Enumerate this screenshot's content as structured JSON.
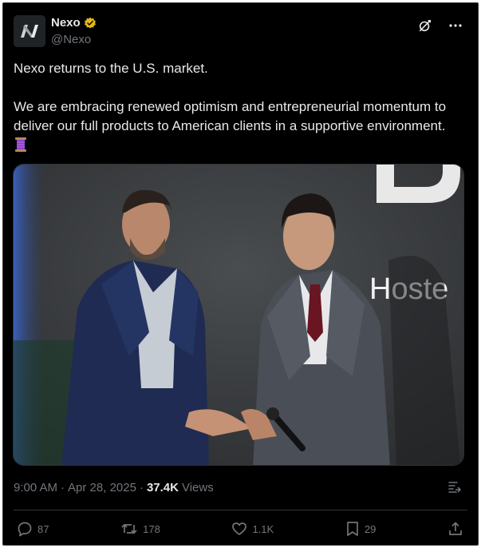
{
  "account": {
    "name": "Nexo",
    "handle": "@Nexo",
    "verified_color": "#e2b719"
  },
  "post": {
    "line1": "Nexo returns to the U.S. market.",
    "line2": "We are embracing renewed optimism and entrepreneurial momentum to deliver our full products to American clients in a supportive environment.",
    "emoji": "spool-of-thread"
  },
  "media": {
    "backdrop_text": "Hoste",
    "backdrop_logo_fragment": "D"
  },
  "meta": {
    "time": "9:00 AM",
    "separator": "·",
    "date": "Apr 28, 2025",
    "separator2": "·",
    "views_count": "37.4K",
    "views_label": "Views"
  },
  "actions": {
    "replies": "87",
    "reposts": "178",
    "likes": "1.1K",
    "bookmarks": "29"
  },
  "icons": [
    "grok-icon",
    "more-icon",
    "analytics-icon",
    "reply-icon",
    "repost-icon",
    "like-icon",
    "bookmark-icon",
    "share-icon"
  ]
}
